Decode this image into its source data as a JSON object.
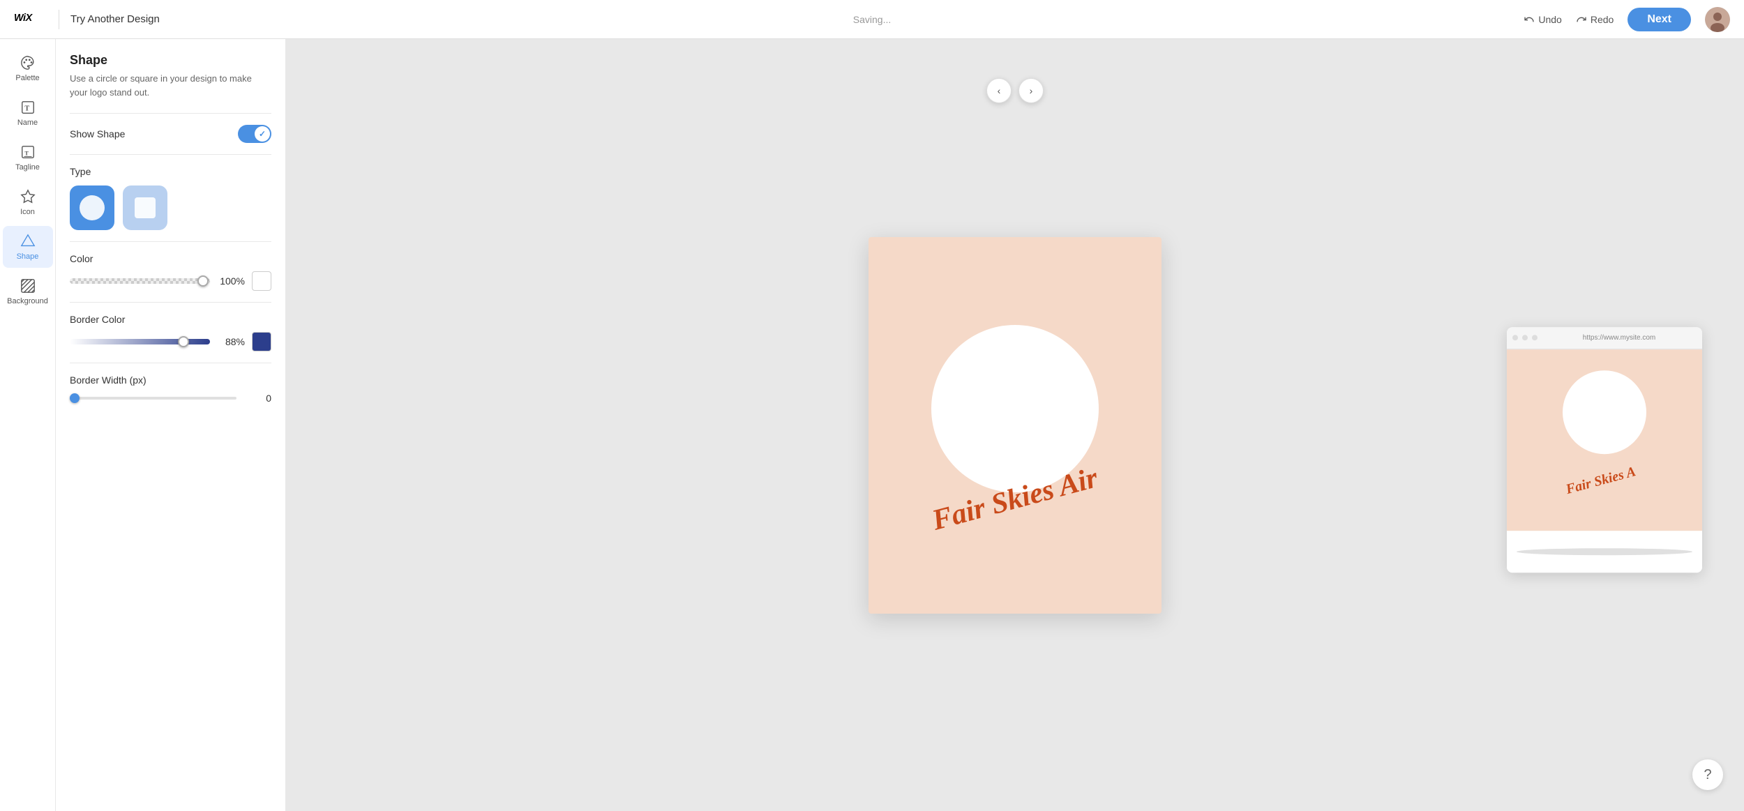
{
  "topbar": {
    "logo": "WiX",
    "divider": "|",
    "subtitle": "Try Another Design",
    "saving": "Saving...",
    "undo_label": "Undo",
    "redo_label": "Redo",
    "next_label": "Next"
  },
  "sidebar": {
    "items": [
      {
        "id": "palette",
        "label": "Palette",
        "icon": "palette-icon"
      },
      {
        "id": "name",
        "label": "Name",
        "icon": "name-icon"
      },
      {
        "id": "tagline",
        "label": "Tagline",
        "icon": "tagline-icon"
      },
      {
        "id": "icon",
        "label": "Icon",
        "icon": "icon-icon"
      },
      {
        "id": "shape",
        "label": "Shape",
        "icon": "shape-icon",
        "active": true
      },
      {
        "id": "background",
        "label": "Background",
        "icon": "background-icon"
      }
    ]
  },
  "panel": {
    "title": "Shape",
    "description": "Use a circle or square in your design to make your logo stand out.",
    "show_shape_label": "Show Shape",
    "show_shape_value": true,
    "type_label": "Type",
    "type_options": [
      {
        "id": "circle",
        "selected": true
      },
      {
        "id": "square",
        "selected": false
      }
    ],
    "color_label": "Color",
    "color_percent": "100%",
    "color_value": "#ffffff",
    "border_color_label": "Border Color",
    "border_color_percent": "88%",
    "border_color_value": "#2c3e8c",
    "border_width_label": "Border Width (px)",
    "border_width_value": "0"
  },
  "canvas": {
    "nav_left": "‹",
    "nav_right": "›",
    "logo_text": "Fair Skies Air",
    "background_color": "#f5d9c8",
    "circle_color": "#ffffff",
    "text_color": "#c94a1a"
  },
  "preview": {
    "url": "https://www.mysite.com",
    "logo_text": "Fair Skies A"
  },
  "help": {
    "label": "?"
  }
}
